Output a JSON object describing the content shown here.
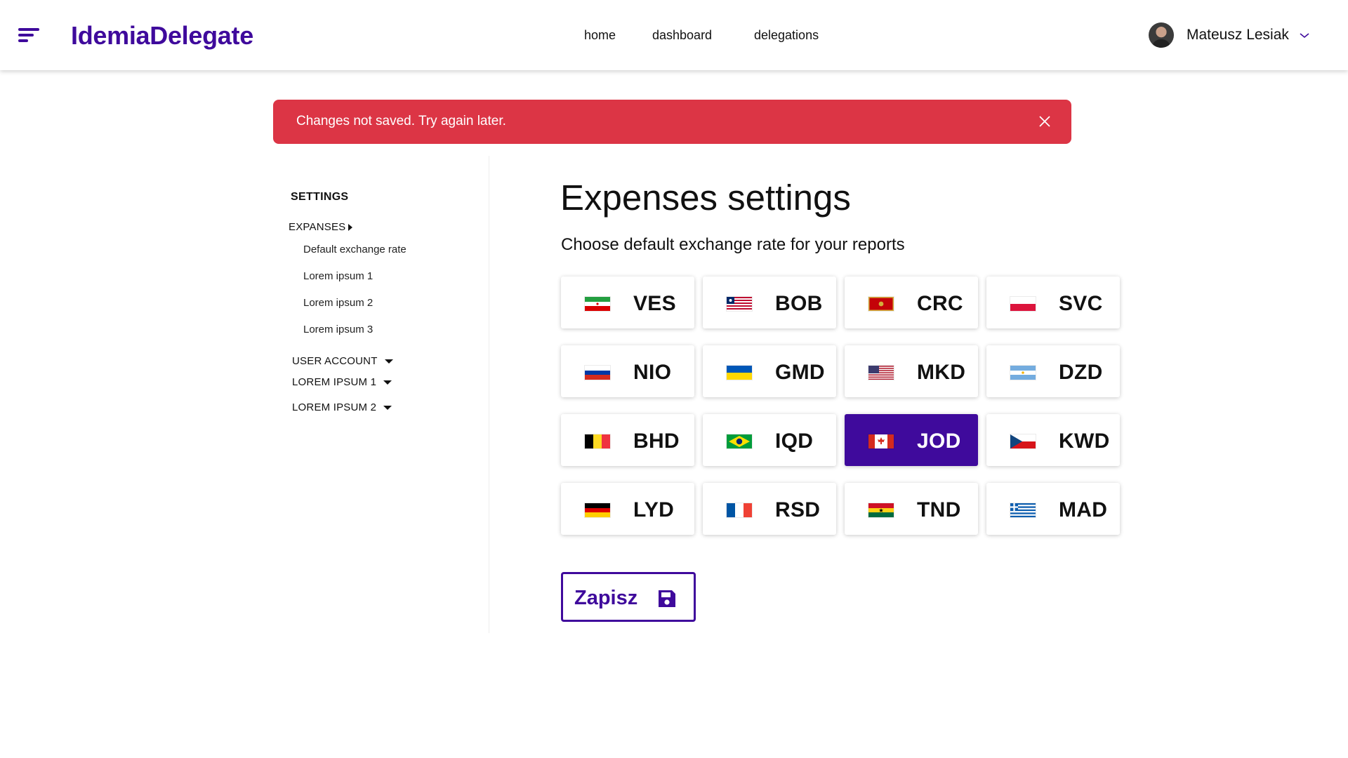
{
  "header": {
    "brand": "IdemiaDelegate",
    "nav": [
      "home",
      "dashboard",
      "delegations"
    ],
    "user_name": "Mateusz Lesiak"
  },
  "alert": {
    "message": "Changes not saved. Try again later.",
    "color": "#dc3545"
  },
  "sidebar": {
    "title": "SETTINGS",
    "expanded_group": "EXPANSES",
    "sub_items": [
      "Default exchange rate",
      "Lorem ipsum 1",
      "Lorem ipsum 2",
      "Lorem ipsum 3"
    ],
    "collapsed_groups": [
      "USER ACCOUNT",
      "LOREM IPSUM 1",
      "LOREM IPSUM 2"
    ]
  },
  "main": {
    "title": "Expenses settings",
    "subtitle": "Choose default exchange rate for your reports",
    "currencies": [
      {
        "code": "VES",
        "flag": "iran-flag-icon"
      },
      {
        "code": "BOB",
        "flag": "liberia-flag-icon"
      },
      {
        "code": "CRC",
        "flag": "montenegro-flag-icon"
      },
      {
        "code": "SVC",
        "flag": "poland-flag-icon"
      },
      {
        "code": "NIO",
        "flag": "russia-flag-icon"
      },
      {
        "code": "GMD",
        "flag": "ukraine-flag-icon"
      },
      {
        "code": "MKD",
        "flag": "usa-flag-icon"
      },
      {
        "code": "DZD",
        "flag": "argentina-flag-icon"
      },
      {
        "code": "BHD",
        "flag": "belgium-flag-icon"
      },
      {
        "code": "IQD",
        "flag": "brazil-flag-icon"
      },
      {
        "code": "JOD",
        "flag": "canada-flag-icon"
      },
      {
        "code": "KWD",
        "flag": "czech-flag-icon"
      },
      {
        "code": "LYD",
        "flag": "germany-flag-icon"
      },
      {
        "code": "RSD",
        "flag": "france-flag-icon"
      },
      {
        "code": "TND",
        "flag": "ghana-flag-icon"
      },
      {
        "code": "MAD",
        "flag": "greece-flag-icon"
      }
    ],
    "selected_currency": "JOD",
    "save_label": "Zapisz"
  },
  "colors": {
    "brand": "#3f0a9c",
    "alert": "#dc3545"
  }
}
